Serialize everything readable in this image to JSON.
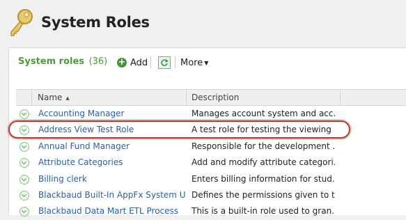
{
  "page": {
    "title": "System Roles"
  },
  "toolbar": {
    "section_title": "System roles",
    "count": "(36)",
    "add_label": "Add",
    "more_label": "More"
  },
  "grid": {
    "columns": {
      "name": "Name",
      "description": "Description"
    },
    "rows": [
      {
        "name": "Accounting Manager",
        "description": "Manages account system and acc..."
      },
      {
        "name": "Address View Test Role",
        "description": "A test role for testing the viewing ..."
      },
      {
        "name": "Annual Fund Manager",
        "description": "Responsible for the development ..."
      },
      {
        "name": "Attribute Categories",
        "description": "Add and modify attribute categori..."
      },
      {
        "name": "Billing clerk",
        "description": "Enters billing information for stud..."
      },
      {
        "name": "Blackbaud Built-In AppFx System U...",
        "description": "Defines the permissions given to t..."
      },
      {
        "name": "Blackbaud Data Mart ETL Process",
        "description": "This is a built-in role used to gran..."
      }
    ]
  },
  "colors": {
    "accent_green": "#4c9a3a",
    "link_blue": "#2a5fa0",
    "highlight_red": "#c0392b"
  }
}
